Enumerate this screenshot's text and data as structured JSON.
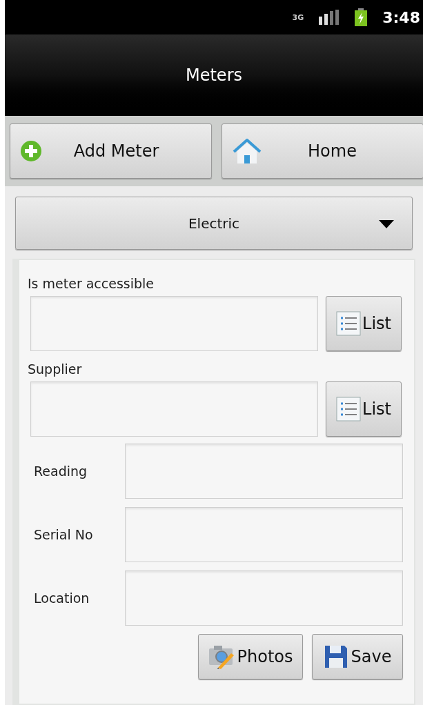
{
  "status_bar": {
    "network_type": "3G",
    "time": "3:48"
  },
  "title": "Meters",
  "toolbar": [
    {
      "kind": "add",
      "label": "Add Meter"
    },
    {
      "kind": "home",
      "label": "Home"
    }
  ],
  "meter_type": {
    "value": "Electric"
  },
  "list_fields": [
    {
      "label": "Is meter accessible",
      "button": "List"
    },
    {
      "label": "Supplier",
      "button": "List"
    }
  ],
  "text_fields": [
    {
      "label": "Reading"
    },
    {
      "label": "Serial No"
    },
    {
      "label": "Location"
    }
  ],
  "actions": [
    {
      "kind": "photos",
      "label": "Photos"
    },
    {
      "kind": "save",
      "label": "Save"
    }
  ]
}
